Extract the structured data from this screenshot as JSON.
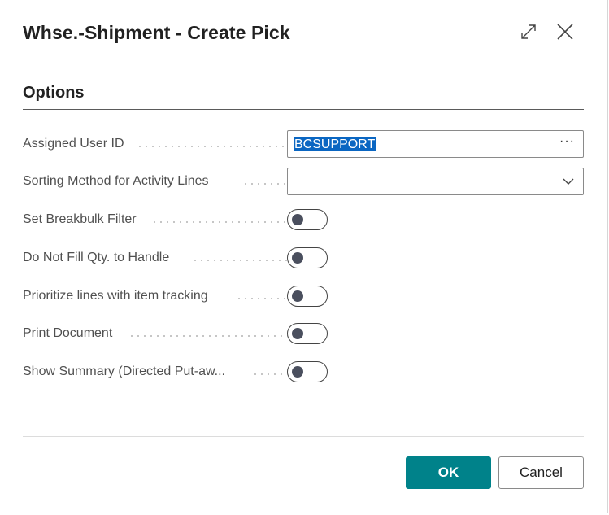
{
  "dialog": {
    "title": "Whse.-Shipment - Create Pick",
    "expand_icon": "expand-diagonal-arrows-icon",
    "close_icon": "close-x-icon"
  },
  "section": {
    "title": "Options"
  },
  "fields": [
    {
      "label": "Assigned User ID",
      "type": "lookup",
      "value": "BCSUPPORT",
      "lookup_icon": "ellipsis-icon"
    },
    {
      "label": "Sorting Method for Activity Lines",
      "type": "select",
      "value": "",
      "dropdown_icon": "chevron-down-icon"
    },
    {
      "label": "Set Breakbulk Filter",
      "type": "toggle",
      "value": false
    },
    {
      "label": "Do Not Fill Qty. to Handle",
      "type": "toggle",
      "value": false
    },
    {
      "label": "Prioritize lines with item tracking",
      "type": "toggle",
      "value": false
    },
    {
      "label": "Print Document",
      "type": "toggle",
      "value": false
    },
    {
      "label": "Show Summary (Directed Put-aw...",
      "type": "toggle",
      "value": false
    }
  ],
  "ellipsis_text": "···",
  "buttons": {
    "ok": "OK",
    "cancel": "Cancel"
  },
  "colors": {
    "accent": "#00828a",
    "selection": "#0a66c2",
    "toggle_knob": "#4a4f5e"
  }
}
